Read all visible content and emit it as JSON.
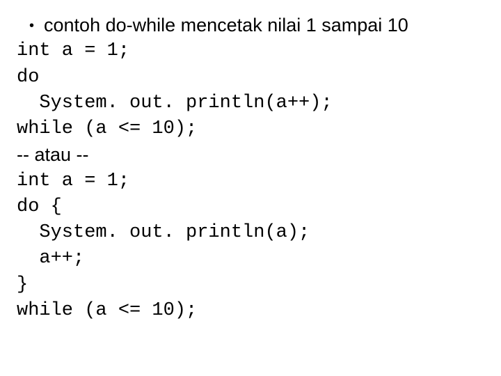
{
  "bullet": {
    "text": "contoh do-while mencetak nilai 1 sampai 10"
  },
  "code_block_1": {
    "line1": "int a = 1;",
    "line2": "do",
    "line3": "System. out. println(a++);",
    "line4": "while (a <= 10);"
  },
  "separator": {
    "text": "-- atau --"
  },
  "code_block_2": {
    "line1": "int a = 1;",
    "line2": "do {",
    "line3": "System. out. println(a);",
    "line4": "a++;",
    "line5": "}",
    "line6": "while (a <= 10);"
  }
}
